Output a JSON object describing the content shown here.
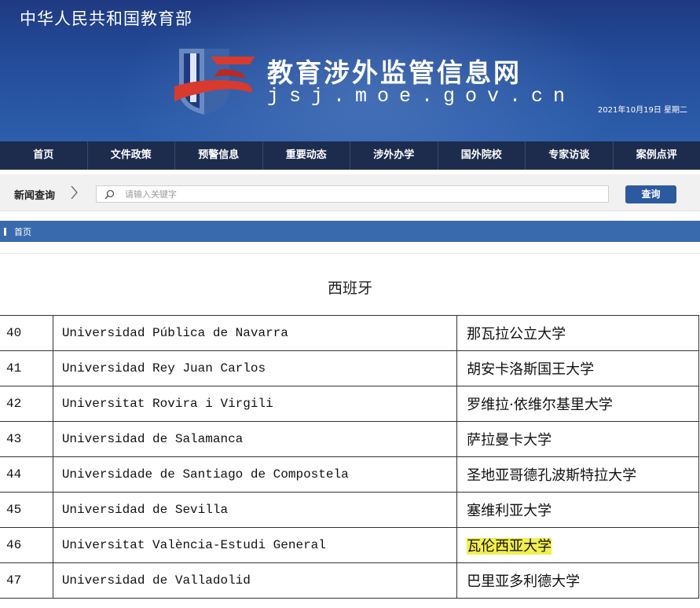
{
  "header": {
    "ministry": "中华人民共和国教育部",
    "site_title": "教育涉外监管信息网",
    "site_url": "jsj.moe.gov.cn",
    "date": "2021年10月19日 星期二",
    "colors": {
      "banner": "#244d9a",
      "nav": "#1d2b4d"
    }
  },
  "nav": {
    "items": [
      "首页",
      "文件政策",
      "预警信息",
      "重要动态",
      "涉外办学",
      "国外院校",
      "专家访谈",
      "案例点评"
    ]
  },
  "search": {
    "label": "新闻查询",
    "placeholder": "请输入关键字",
    "button": "查询"
  },
  "breadcrumb": {
    "home": "首页"
  },
  "content": {
    "heading": "西班牙",
    "rows": [
      {
        "num": "40",
        "name": "Universidad Pública de Navarra",
        "cn": "那瓦拉公立大学"
      },
      {
        "num": "41",
        "name": "Universidad Rey Juan Carlos",
        "cn": "胡安卡洛斯国王大学"
      },
      {
        "num": "42",
        "name": "Universitat Rovira i Virgili",
        "cn": "罗维拉·依维尔基里大学"
      },
      {
        "num": "43",
        "name": "Universidad de Salamanca",
        "cn": "萨拉曼卡大学"
      },
      {
        "num": "44",
        "name": "Universidade de Santiago de Compostela",
        "cn": "圣地亚哥德孔波斯特拉大学"
      },
      {
        "num": "45",
        "name": "Universidad de Sevilla",
        "cn": "塞维利亚大学"
      },
      {
        "num": "46",
        "name": "Universitat València-Estudi General",
        "cn": "瓦伦西亚大学",
        "highlight_color": "#f3ef4a"
      },
      {
        "num": "47",
        "name": "Universidad de Valladolid",
        "cn": "巴里亚多利德大学"
      }
    ]
  }
}
